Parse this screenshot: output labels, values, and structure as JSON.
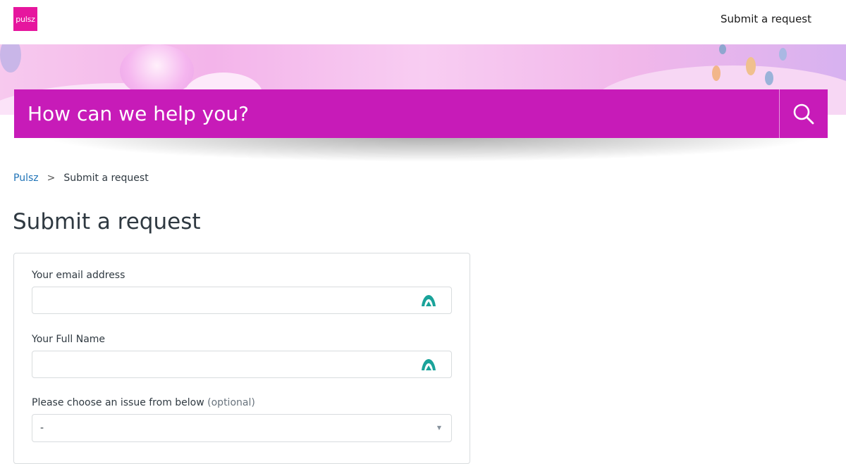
{
  "header": {
    "logo_text": "pulsz",
    "nav_link": "Submit a request",
    "brand_color": "#e6169e"
  },
  "hero": {
    "search_placeholder": "How can we help you?",
    "search_color": "#c71bb8",
    "search_icon": "search-icon"
  },
  "breadcrumb": {
    "home": "Pulsz",
    "separator": ">",
    "current": "Submit a request"
  },
  "main": {
    "title": "Submit a request",
    "form": {
      "email": {
        "label": "Your email address",
        "value": ""
      },
      "name": {
        "label": "Your Full Name",
        "value": ""
      },
      "issue": {
        "label": "Please choose an issue from below",
        "optional": "(optional)",
        "selected": "-"
      }
    }
  }
}
